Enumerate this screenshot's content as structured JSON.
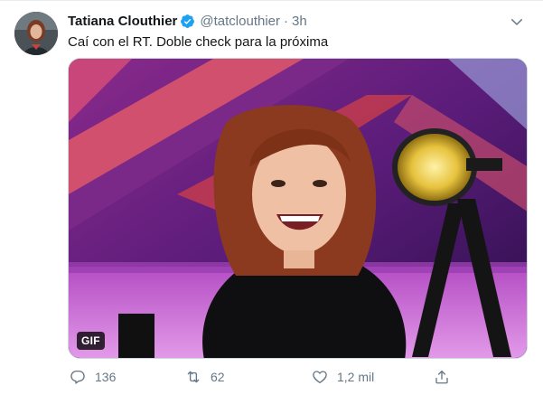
{
  "tweet": {
    "author_name": "Tatiana Clouthier",
    "handle": "@tatclouthier",
    "separator": "·",
    "time": "3h",
    "text": "Caí con el RT. Doble check para la próxima",
    "media": {
      "badge": "GIF",
      "icon": "gif-image"
    },
    "actions": {
      "replies": "136",
      "retweets": "62",
      "likes": "1,2 mil"
    }
  },
  "colors": {
    "accent": "#1da1f2",
    "muted": "#657786",
    "text": "#14171a"
  }
}
